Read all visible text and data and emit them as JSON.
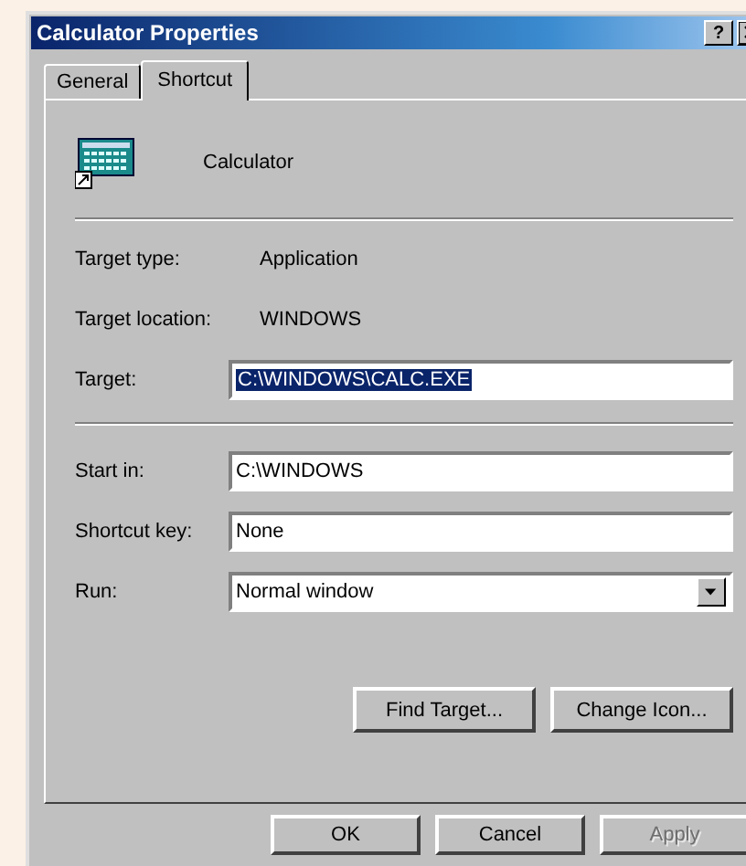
{
  "window": {
    "title": "Calculator Properties",
    "help_button": "?"
  },
  "tabs": [
    {
      "label": "General",
      "selected": false
    },
    {
      "label": "Shortcut",
      "selected": true
    }
  ],
  "header": {
    "name": "Calculator"
  },
  "info": [
    {
      "label": "Target type:",
      "value": "Application"
    },
    {
      "label": "Target location:",
      "value": "WINDOWS"
    }
  ],
  "target": {
    "label": "Target:",
    "value": "C:\\WINDOWS\\CALC.EXE",
    "text_selected": true
  },
  "fields": [
    {
      "kind": "input",
      "label": "Start in:",
      "value": "C:\\WINDOWS"
    },
    {
      "kind": "input",
      "label": "Shortcut key:",
      "value": "None"
    },
    {
      "kind": "dropdown",
      "label": "Run:",
      "value": "Normal window"
    }
  ],
  "panel_buttons": [
    {
      "label": "Find Target...",
      "disabled": false
    },
    {
      "label": "Change Icon...",
      "disabled": false
    }
  ],
  "dialog_buttons": [
    {
      "label": "OK",
      "disabled": false
    },
    {
      "label": "Cancel",
      "disabled": false
    },
    {
      "label": "Apply",
      "disabled": true
    }
  ]
}
